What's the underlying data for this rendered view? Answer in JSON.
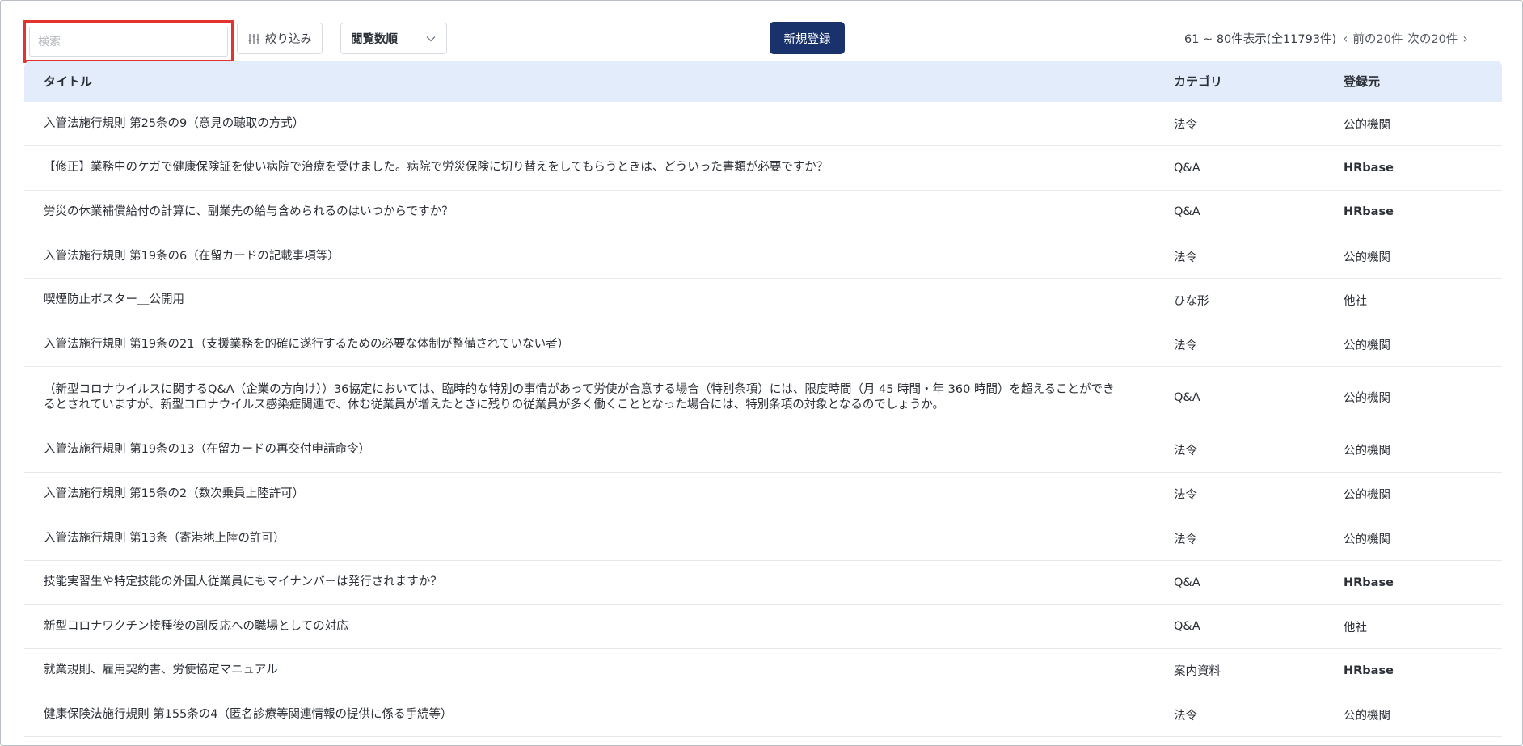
{
  "toolbar": {
    "search_placeholder": "検索",
    "search_value": "",
    "filter_label": "絞り込み",
    "sort_value": "閲覧数順",
    "new_button_label": "新規登録",
    "pager_info": "61 ~ 80件表示(全11793件)",
    "prev_label": "前の20件",
    "next_label": "次の20件"
  },
  "table": {
    "headers": {
      "title": "タイトル",
      "category": "カテゴリ",
      "registrant": "登録元"
    },
    "rows": [
      {
        "title": "入管法施行規則 第25条の9（意見の聴取の方式）",
        "category": "法令",
        "registrant": "公的機関"
      },
      {
        "title": "【修正】業務中のケガで健康保険証を使い病院で治療を受けました。病院で労災保険に切り替えをしてもらうときは、どういった書類が必要ですか？",
        "category": "Q&A",
        "registrant": "HRbase"
      },
      {
        "title": "労災の休業補償給付の計算に、副業先の給与含められるのはいつからですか？",
        "category": "Q&A",
        "registrant": "HRbase"
      },
      {
        "title": "入管法施行規則 第19条の6（在留カードの記載事項等）",
        "category": "法令",
        "registrant": "公的機関"
      },
      {
        "title": "喫煙防止ポスター＿公開用",
        "category": "ひな形",
        "registrant": "他社"
      },
      {
        "title": "入管法施行規則 第19条の21（支援業務を的確に遂行するための必要な体制が整備されていない者）",
        "category": "法令",
        "registrant": "公的機関"
      },
      {
        "title": "（新型コロナウイルスに関するQ&A（企業の方向け））36協定においては、臨時的な特別の事情があって労使が合意する場合（特別条項）には、限度時間（月 45 時間・年 360 時間）を超えることができるとされていますが、新型コロナウイルス感染症関連で、休む従業員が増えたときに残りの従業員が多く働くこととなった場合には、特別条項の対象となるのでしょうか。",
        "category": "Q&A",
        "registrant": "公的機関"
      },
      {
        "title": "入管法施行規則 第19条の13（在留カードの再交付申請命令）",
        "category": "法令",
        "registrant": "公的機関"
      },
      {
        "title": "入管法施行規則 第15条の2（数次乗員上陸許可）",
        "category": "法令",
        "registrant": "公的機関"
      },
      {
        "title": "入管法施行規則 第13条（寄港地上陸の許可）",
        "category": "法令",
        "registrant": "公的機関"
      },
      {
        "title": "技能実習生や特定技能の外国人従業員にもマイナンバーは発行されますか？",
        "category": "Q&A",
        "registrant": "HRbase"
      },
      {
        "title": "新型コロナワクチン接種後の副反応への職場としての対応",
        "category": "Q&A",
        "registrant": "他社"
      },
      {
        "title": "就業規則、雇用契約書、労使協定マニュアル",
        "category": "案内資料",
        "registrant": "HRbase"
      },
      {
        "title": "健康保険法施行規則 第155条の4（匿名診療等関連情報の提供に係る手続等）",
        "category": "法令",
        "registrant": "公的機関"
      }
    ]
  },
  "colors": {
    "highlight": "#e3332d",
    "primary": "#19326b",
    "header_bg": "#e3ecfa"
  }
}
